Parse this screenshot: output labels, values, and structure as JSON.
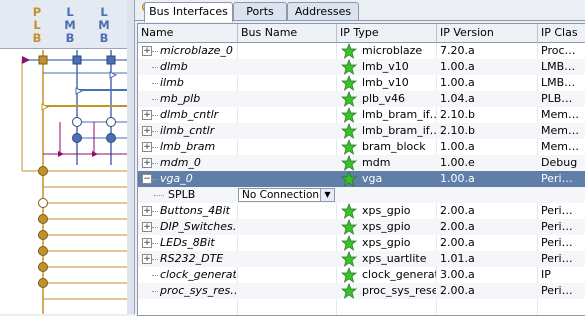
{
  "bus_header": {
    "labels": [
      {
        "letters": [
          "P",
          "L",
          "B"
        ],
        "color": "#c4922a"
      },
      {
        "letters": [
          "L",
          "M",
          "B"
        ],
        "color": "#4a6fb5"
      },
      {
        "letters": [
          "L",
          "M",
          "B"
        ],
        "color": "#4a6fb5"
      }
    ]
  },
  "tabs": [
    {
      "label": "Bus Interfaces",
      "active": true
    },
    {
      "label": "Ports",
      "active": false
    },
    {
      "label": "Addresses",
      "active": false
    }
  ],
  "columns": [
    "Name",
    "Bus Name",
    "IP Type",
    "IP Version",
    "IP Clas"
  ],
  "rows": [
    {
      "name": "microblaze_0",
      "bus": "",
      "type": "microblaze",
      "version": "7.20.a",
      "cls": "Proc…",
      "expander": "+",
      "selected": false,
      "child": false
    },
    {
      "name": "dlmb",
      "bus": "",
      "type": "lmb_v10",
      "version": "1.00.a",
      "cls": "LMB…",
      "expander": "",
      "selected": false,
      "child": false
    },
    {
      "name": "ilmb",
      "bus": "",
      "type": "lmb_v10",
      "version": "1.00.a",
      "cls": "LMB…",
      "expander": "",
      "selected": false,
      "child": false
    },
    {
      "name": "mb_plb",
      "bus": "",
      "type": "plb_v46",
      "version": "1.04.a",
      "cls": "PLB…",
      "expander": "",
      "selected": false,
      "child": false
    },
    {
      "name": "dlmb_cntlr",
      "bus": "",
      "type": "lmb_bram_if…",
      "version": "2.10.b",
      "cls": "Mem…",
      "expander": "+",
      "selected": false,
      "child": false
    },
    {
      "name": "ilmb_cntlr",
      "bus": "",
      "type": "lmb_bram_if…",
      "version": "2.10.b",
      "cls": "Mem…",
      "expander": "+",
      "selected": false,
      "child": false
    },
    {
      "name": "lmb_bram",
      "bus": "",
      "type": "bram_block",
      "version": "1.00.a",
      "cls": "Mem…",
      "expander": "+",
      "selected": false,
      "child": false
    },
    {
      "name": "mdm_0",
      "bus": "",
      "type": "mdm",
      "version": "1.00.e",
      "cls": "Debug",
      "expander": "+",
      "selected": false,
      "child": false
    },
    {
      "name": "vga_0",
      "bus": "",
      "type": "vga",
      "version": "1.00.a",
      "cls": "Peri…",
      "expander": "−",
      "selected": true,
      "child": false
    },
    {
      "name": "SPLB",
      "bus": "No Connection",
      "type": "",
      "version": "",
      "cls": "",
      "expander": "",
      "selected": false,
      "child": true
    },
    {
      "name": "Buttons_4Bit",
      "bus": "",
      "type": "xps_gpio",
      "version": "2.00.a",
      "cls": "Peri…",
      "expander": "+",
      "selected": false,
      "child": false
    },
    {
      "name": "DIP_Switches…",
      "bus": "",
      "type": "xps_gpio",
      "version": "2.00.a",
      "cls": "Peri…",
      "expander": "+",
      "selected": false,
      "child": false
    },
    {
      "name": "LEDs_8Bit",
      "bus": "",
      "type": "xps_gpio",
      "version": "2.00.a",
      "cls": "Peri…",
      "expander": "+",
      "selected": false,
      "child": false
    },
    {
      "name": "RS232_DTE",
      "bus": "",
      "type": "xps_uartlite",
      "version": "1.01.a",
      "cls": "Peri…",
      "expander": "+",
      "selected": false,
      "child": false
    },
    {
      "name": "clock_generat…",
      "bus": "",
      "type": "clock_generator",
      "version": "3.00.a",
      "cls": "IP",
      "expander": "",
      "selected": false,
      "child": false
    },
    {
      "name": "proc_sys_res…",
      "bus": "",
      "type": "proc_sys_reset",
      "version": "2.00.a",
      "cls": "Peri…",
      "expander": "",
      "selected": false,
      "child": false
    }
  ],
  "colors": {
    "selection": "#5f7ea8",
    "star": "#3bbf2e",
    "plb_bus": "#c4922a",
    "lmb_bus": "#4a6fb5",
    "connector": "#8a0f6e"
  }
}
